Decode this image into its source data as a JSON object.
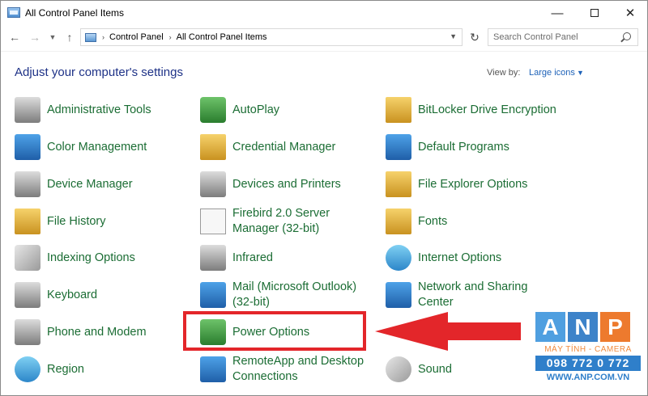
{
  "window": {
    "title": "All Control Panel Items"
  },
  "titlebar_buttons": {
    "minimize": "—",
    "close": "✕"
  },
  "address": {
    "segments": [
      "Control Panel",
      "All Control Panel Items"
    ]
  },
  "search": {
    "placeholder": "Search Control Panel"
  },
  "header": {
    "title": "Adjust your computer's settings",
    "view_by_label": "View by:",
    "view_by_value": "Large icons"
  },
  "items": [
    {
      "label": "Administrative Tools",
      "icon": "admin-tools-icon"
    },
    {
      "label": "AutoPlay",
      "icon": "autoplay-icon"
    },
    {
      "label": "BitLocker Drive Encryption",
      "icon": "bitlocker-icon"
    },
    {
      "label": "Color Management",
      "icon": "color-management-icon"
    },
    {
      "label": "Credential Manager",
      "icon": "credential-manager-icon"
    },
    {
      "label": "Default Programs",
      "icon": "default-programs-icon"
    },
    {
      "label": "Device Manager",
      "icon": "device-manager-icon"
    },
    {
      "label": "Devices and Printers",
      "icon": "printer-icon"
    },
    {
      "label": "File Explorer Options",
      "icon": "folder-options-icon"
    },
    {
      "label": "File History",
      "icon": "file-history-icon"
    },
    {
      "label": "Firebird 2.0 Server Manager (32-bit)",
      "icon": "blank-document-icon"
    },
    {
      "label": "Fonts",
      "icon": "fonts-icon"
    },
    {
      "label": "Indexing Options",
      "icon": "indexing-icon"
    },
    {
      "label": "Infrared",
      "icon": "infrared-icon"
    },
    {
      "label": "Internet Options",
      "icon": "globe-icon"
    },
    {
      "label": "Keyboard",
      "icon": "keyboard-icon"
    },
    {
      "label": "Mail (Microsoft Outlook) (32-bit)",
      "icon": "mail-icon"
    },
    {
      "label": "Network and Sharing Center",
      "icon": "network-icon"
    },
    {
      "label": "Phone and Modem",
      "icon": "phone-icon"
    },
    {
      "label": "Power Options",
      "icon": "battery-icon"
    },
    {
      "label": "Region",
      "icon": "region-icon"
    },
    {
      "label": "RemoteApp and Desktop Connections",
      "icon": "remote-desktop-icon"
    },
    {
      "label": "Sound",
      "icon": "speaker-icon"
    }
  ],
  "annotation": {
    "highlighted_item": "Power Options",
    "color": "#e3262a"
  },
  "watermark": {
    "letters": [
      "A",
      "N",
      "P"
    ],
    "subtitle": "MÁY TÍNH - CAMERA",
    "phone": "098 772 0 772",
    "url": "WWW.ANP.COM.VN"
  },
  "colors": {
    "heading": "#1e3287",
    "item_label": "#1b6d34",
    "link": "#1e62b8"
  }
}
